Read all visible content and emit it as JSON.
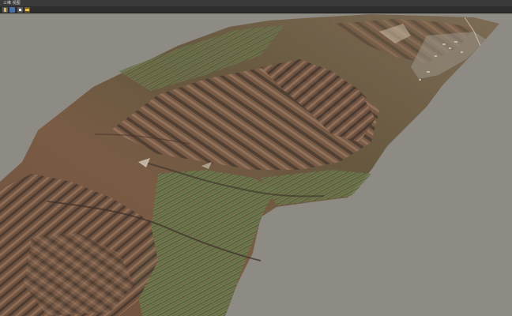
{
  "app": {
    "title": "三维 视图"
  },
  "toolbar": {
    "buttons": [
      {
        "icon": "pointer-tool-icon"
      },
      {
        "icon": "globe-tool-icon"
      },
      {
        "icon": "cube-tool-icon"
      },
      {
        "icon": "folder-tool-icon"
      }
    ]
  },
  "scene": {
    "background_color": "#8e8b85",
    "terrain_colors": {
      "ridge": "#6f4f3a",
      "shadow": "#3c342d",
      "field": "#5b6a40",
      "light": "#b69a83"
    }
  }
}
